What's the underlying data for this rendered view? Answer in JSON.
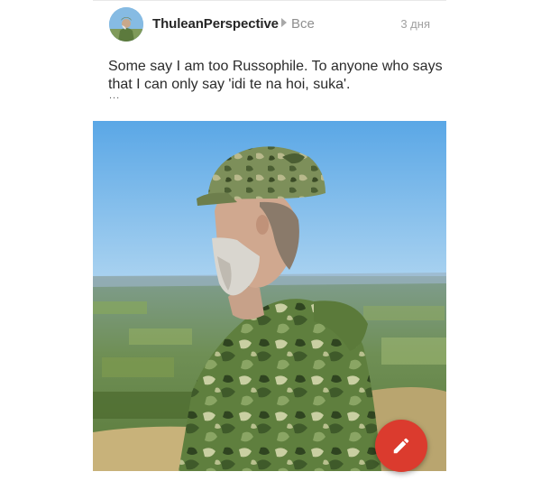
{
  "post": {
    "author": "ThuleanPerspective",
    "audience": "Все",
    "timestamp": "3 дня",
    "text": "Some say I am too Russophile. To anyone who says that I can only say 'idi te na hoi, suka'.",
    "more": "..."
  },
  "icons": {
    "audience_arrow": "play-arrow-icon",
    "fab": "pencil-icon"
  },
  "colors": {
    "fab": "#db3b2e",
    "author": "#262626",
    "meta": "#a0a0a0"
  }
}
